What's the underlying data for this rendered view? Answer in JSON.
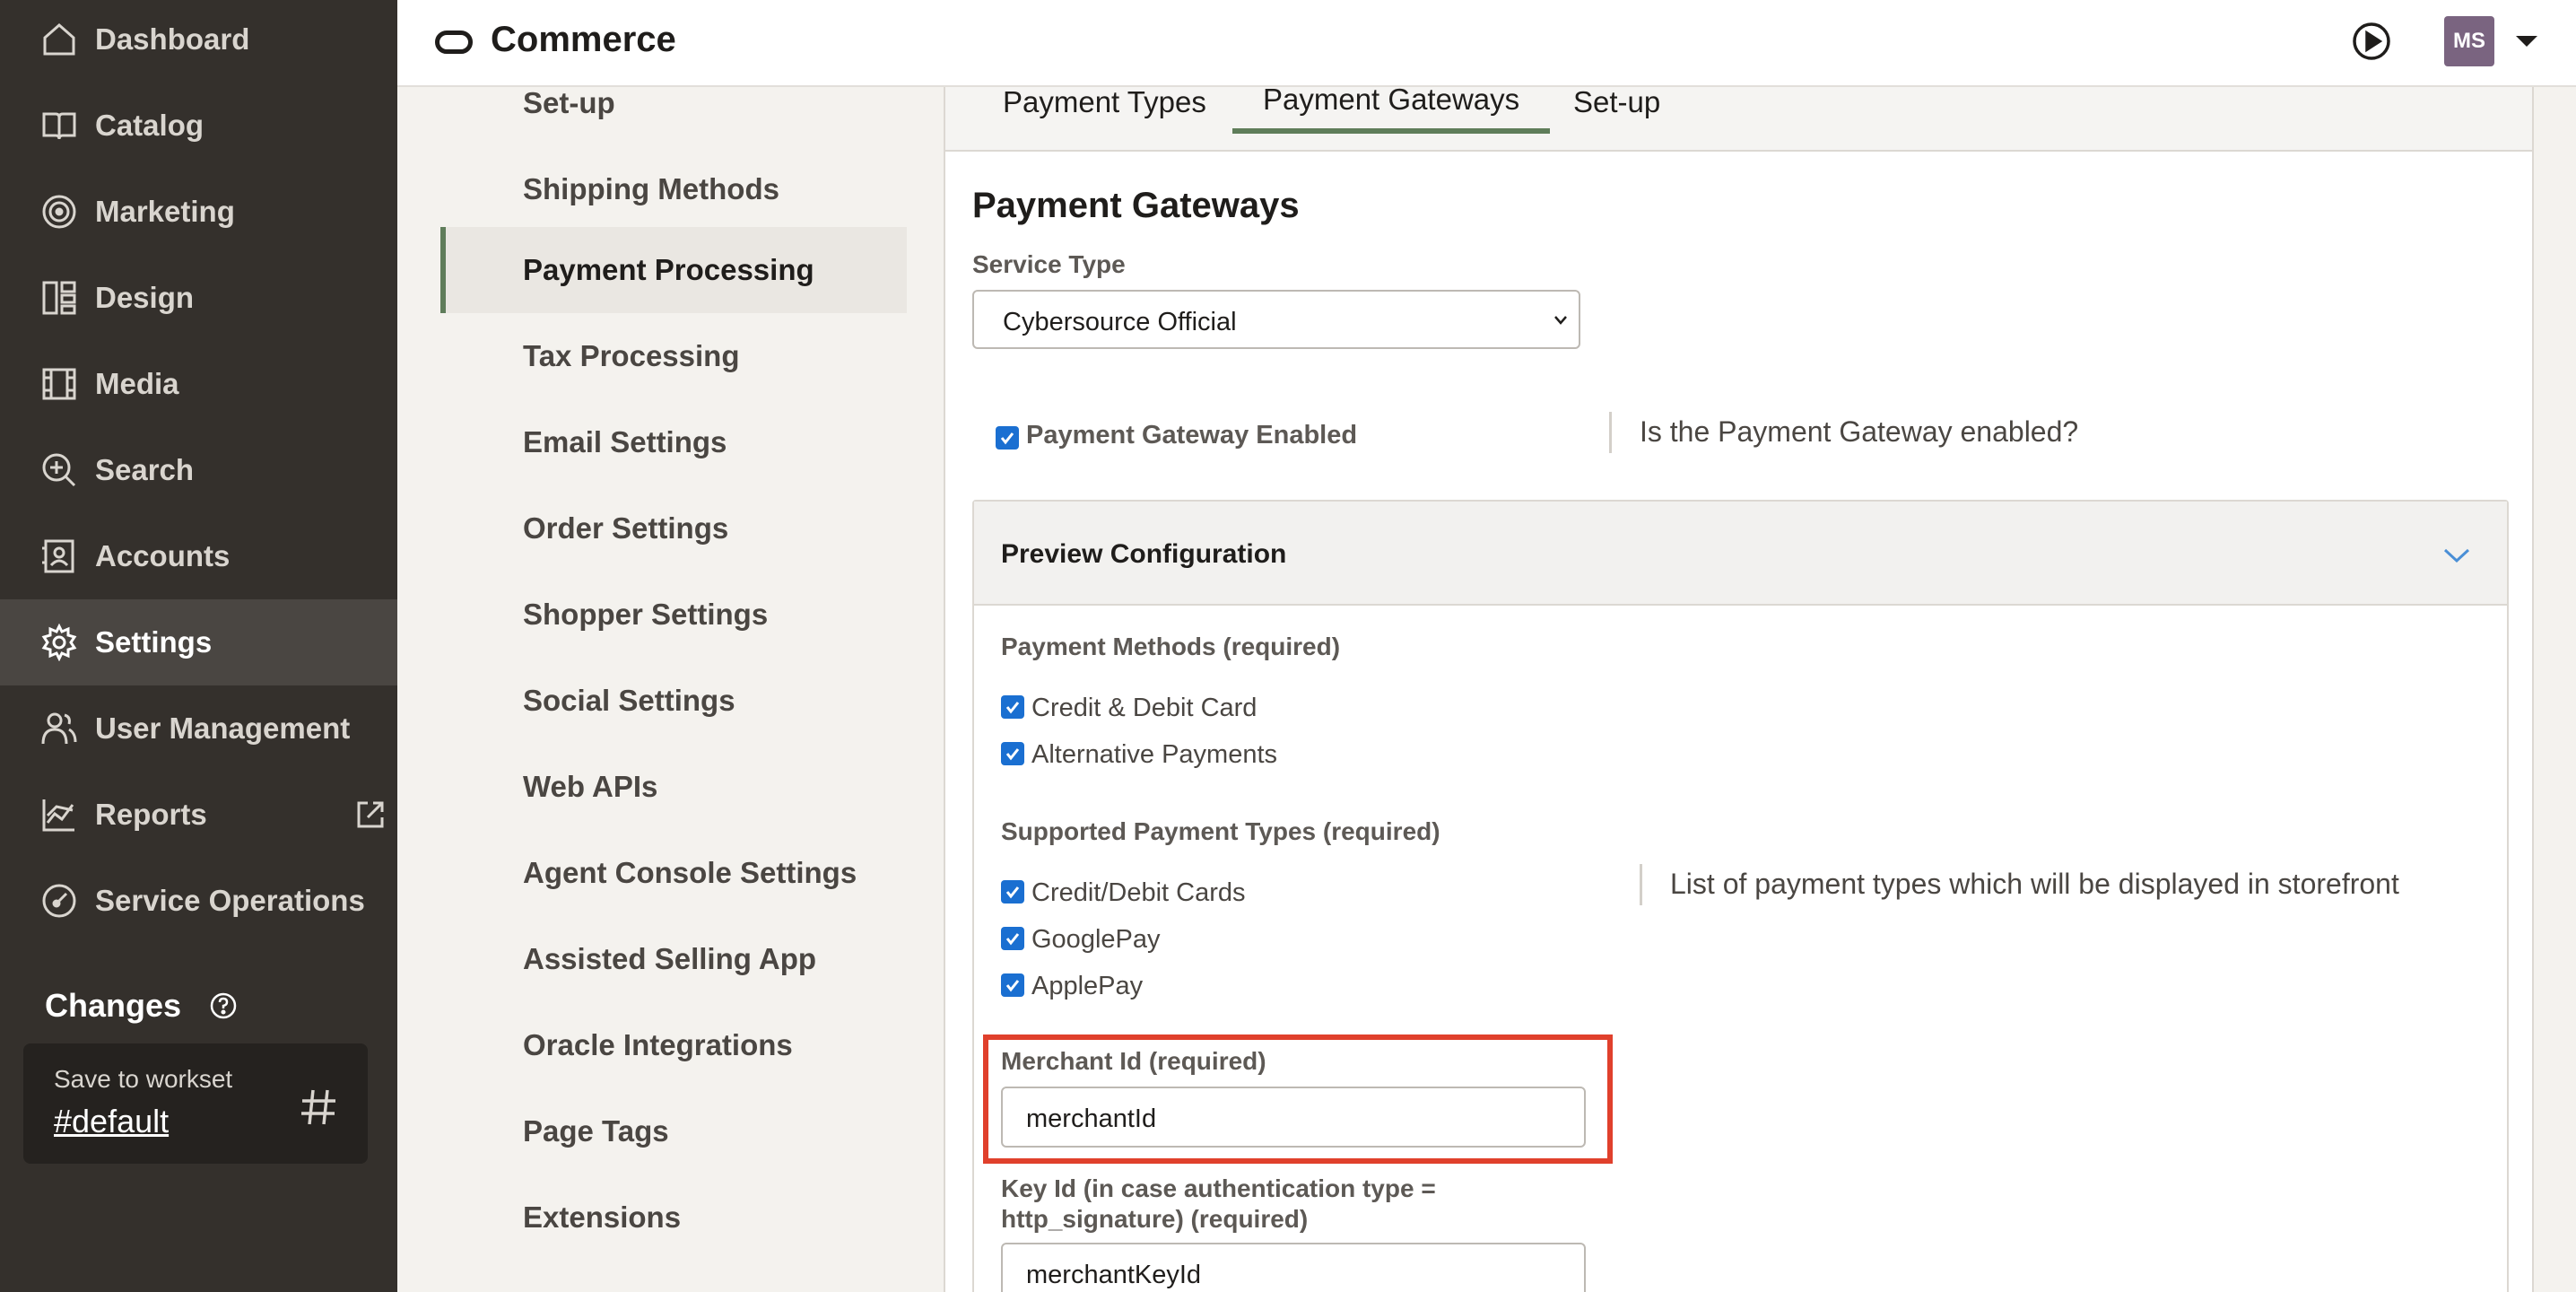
{
  "sidebar": {
    "items": [
      {
        "label": "Dashboard",
        "icon": "home-icon"
      },
      {
        "label": "Catalog",
        "icon": "book-icon"
      },
      {
        "label": "Marketing",
        "icon": "target-icon"
      },
      {
        "label": "Design",
        "icon": "layout-icon"
      },
      {
        "label": "Media",
        "icon": "film-icon"
      },
      {
        "label": "Search",
        "icon": "search-icon"
      },
      {
        "label": "Accounts",
        "icon": "contact-book-icon"
      },
      {
        "label": "Settings",
        "icon": "gear-icon"
      },
      {
        "label": "User Management",
        "icon": "users-icon"
      },
      {
        "label": "Reports",
        "icon": "chart-icon"
      },
      {
        "label": "Service Operations",
        "icon": "gauge-icon"
      }
    ],
    "active": "Settings",
    "changes_title": "Changes",
    "workset_caption": "Save to workset",
    "workset_value": "#default"
  },
  "header": {
    "title": "Commerce",
    "avatar_initials": "MS"
  },
  "subnav": {
    "items": [
      "Set-up",
      "Shipping Methods",
      "Payment Processing",
      "Tax Processing",
      "Email Settings",
      "Order Settings",
      "Shopper Settings",
      "Social Settings",
      "Web APIs",
      "Agent Console Settings",
      "Assisted Selling App",
      "Oracle Integrations",
      "Page Tags",
      "Extensions"
    ],
    "active": "Payment Processing"
  },
  "tabs": [
    "Payment Types",
    "Payment Gateways",
    "Set-up"
  ],
  "active_tab": "Payment Gateways",
  "main": {
    "title": "Payment Gateways",
    "service_type_label": "Service Type",
    "service_type_value": "Cybersource Official",
    "gateway_enabled_label": "Payment Gateway Enabled",
    "gateway_enabled_help": "Is the Payment Gateway enabled?",
    "preview_title": "Preview Configuration",
    "payment_methods_label": "Payment Methods (required)",
    "payment_methods": [
      "Credit & Debit Card",
      "Alternative Payments"
    ],
    "supported_types_label": "Supported Payment Types (required)",
    "supported_types": [
      "Credit/Debit Cards",
      "GooglePay",
      "ApplePay"
    ],
    "supported_types_help": "List of payment types which will be displayed in storefront",
    "merchant_id_label": "Merchant Id (required)",
    "merchant_id_value": "merchantId",
    "key_id_label_line1": "Key Id (in case authentication type =",
    "key_id_label_line2": "http_signature) (required)",
    "key_id_value": "merchantKeyId"
  },
  "colors": {
    "sidebar_bg": "#34302c",
    "accent_green": "#5f7d5a",
    "highlight_red": "#e0402c",
    "checkbox_blue": "#1a6fd1"
  }
}
